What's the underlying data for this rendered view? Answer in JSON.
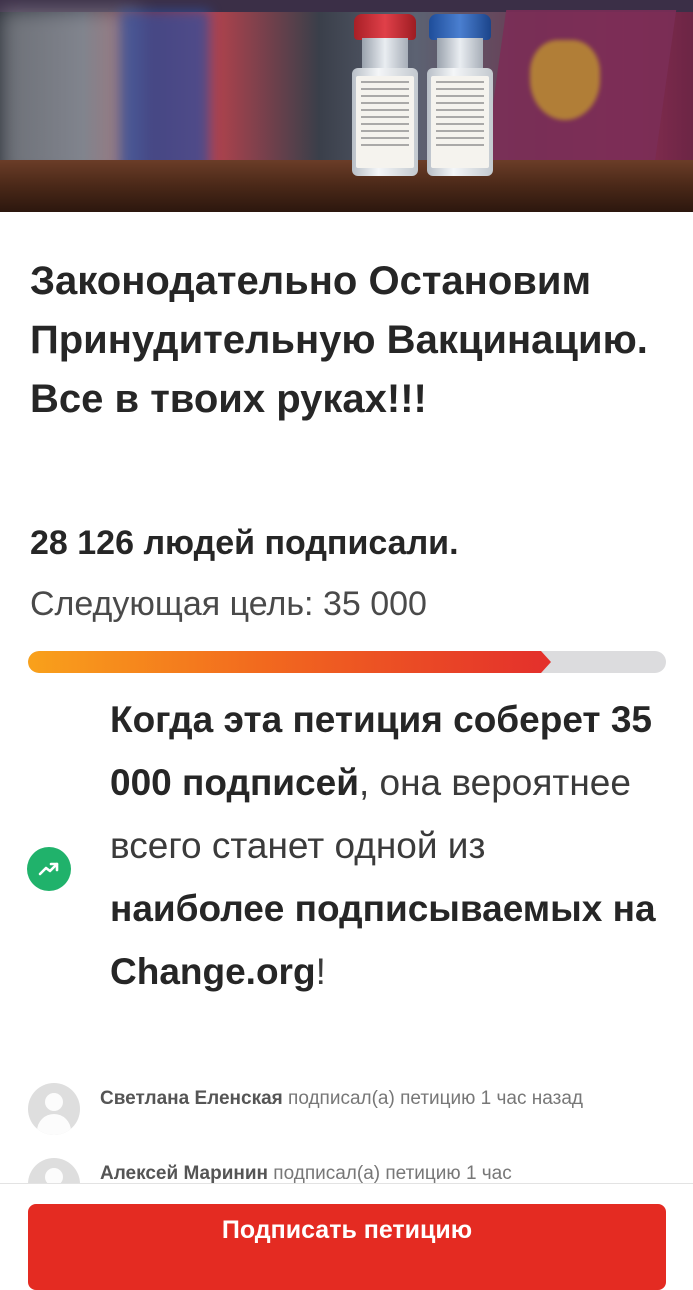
{
  "hero": {
    "image": "vaccine-vials-photo"
  },
  "petition": {
    "title": "Законодательно Остановим Принудительную Вакцинацию. Все в твоих руках!!!",
    "signed_text": "28 126 людей подписали.",
    "goal_text": "Следующая цель: 35 000",
    "signatures": 28126,
    "goal": 35000,
    "progress_fraction": 0.8036
  },
  "info": {
    "icon": "trending-up-icon",
    "part1": "Когда эта петиция соберет 35 000 подписей",
    "part2": ", она вероятнее всего станет одной из ",
    "part3": "наиболее подписываемых на Change.org",
    "part4": "!"
  },
  "signers": [
    {
      "name": "Светлана Еленская",
      "action": " подписал(а) петицию 1 час назад"
    },
    {
      "name": "Алексей Маринин",
      "action": " подписал(а) петицию 1 час"
    }
  ],
  "footer": {
    "sign_button": "Подписать петицию"
  },
  "colors": {
    "accent_red": "#e42b22",
    "progress_start": "#f9a11b",
    "progress_end": "#e4312b",
    "trend_green": "#20b26b"
  }
}
